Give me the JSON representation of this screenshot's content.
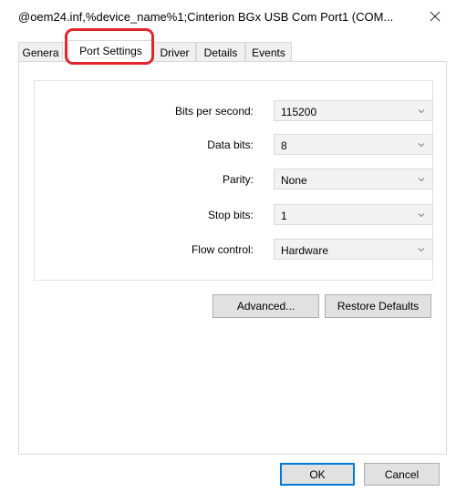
{
  "window": {
    "title": "@oem24.inf,%device_name%1;Cinterion BGx USB Com Port1 (COM...",
    "close_icon": "close-icon"
  },
  "tabs": [
    {
      "label": "Genera",
      "active": false
    },
    {
      "label": "Port Settings",
      "active": true
    },
    {
      "label": "Driver",
      "active": false
    },
    {
      "label": "Details",
      "active": false
    },
    {
      "label": "Events",
      "active": false
    }
  ],
  "port_settings": {
    "bits_per_second": {
      "label": "Bits per second:",
      "value": "115200"
    },
    "data_bits": {
      "label": "Data bits:",
      "value": "8"
    },
    "parity": {
      "label": "Parity:",
      "value": "None"
    },
    "stop_bits": {
      "label": "Stop bits:",
      "value": "1"
    },
    "flow_control": {
      "label": "Flow control:",
      "value": "Hardware"
    }
  },
  "buttons": {
    "advanced": "Advanced...",
    "restore_defaults": "Restore Defaults",
    "ok": "OK",
    "cancel": "Cancel"
  },
  "colors": {
    "highlight": "#e0262b",
    "focus": "#0078d7"
  }
}
